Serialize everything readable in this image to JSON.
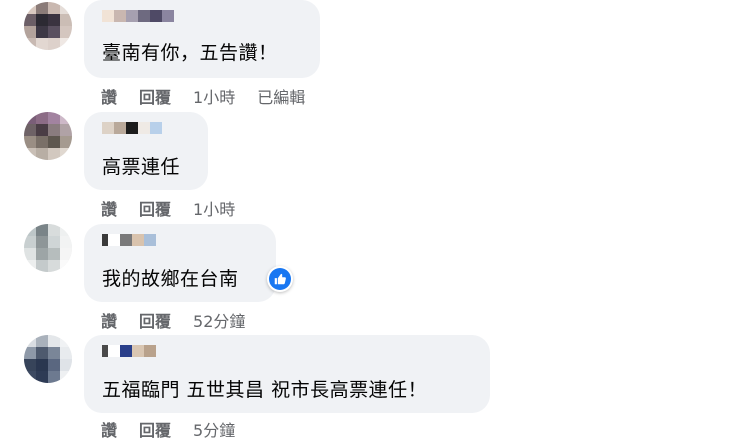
{
  "comments": [
    {
      "text": "臺南有你，五告讚！",
      "like_label": "讚",
      "reply_label": "回覆",
      "time": "1小時",
      "edited": "已編輯"
    },
    {
      "text": "高票連任",
      "like_label": "讚",
      "reply_label": "回覆",
      "time": "1小時"
    },
    {
      "text": "我的故鄉在台南",
      "like_label": "讚",
      "reply_label": "回覆",
      "time": "52分鐘",
      "reaction_icon": "thumbs-up-icon"
    },
    {
      "text": "五福臨門 五世其昌 祝市長高票連任！",
      "like_label": "讚",
      "reply_label": "回覆",
      "time": "5分鐘"
    }
  ],
  "colors": {
    "bubble": "#f0f2f5",
    "secondary_text": "#65676b",
    "primary_text": "#050505",
    "like_blue": "#1877f2"
  }
}
